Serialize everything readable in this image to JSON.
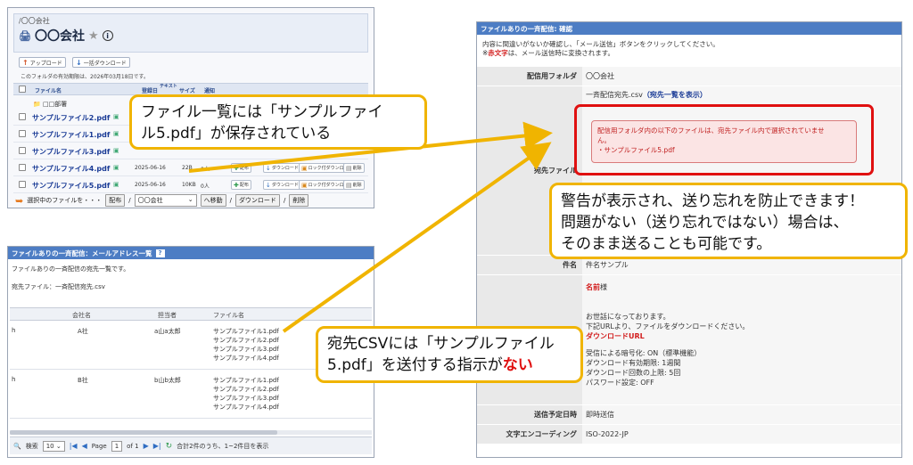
{
  "folder_panel": {
    "breadcrumb": "/〇〇会社",
    "title": "〇〇会社",
    "upload_label": "アップロード",
    "bulk_download_label": "一括ダウンロード",
    "expiry_note": "このフォルダの有効期限は、2026年03月18日です。",
    "columns": {
      "filename": "ファイル名",
      "date": "登録日",
      "text": "テキスト",
      "size": "サイズ",
      "notify": "通知"
    },
    "department": "□□部署",
    "files": [
      {
        "name": "サンプルファイル2.pdf",
        "date": "",
        "size": "",
        "count": ""
      },
      {
        "name": "サンプルファイル1.pdf",
        "date": "",
        "size": "",
        "count": ""
      },
      {
        "name": "サンプルファイル3.pdf",
        "date": "",
        "size": "",
        "count": ""
      },
      {
        "name": "サンプルファイル4.pdf",
        "date": "2025-06-16",
        "size": "22B",
        "count": "0人"
      },
      {
        "name": "サンプルファイル5.pdf",
        "date": "2025-06-16",
        "size": "10KB",
        "count": "0人"
      }
    ],
    "row_actions": {
      "distribute": "配布",
      "download": "ダウンロード",
      "locked_dl": "ロック付ダウンロード",
      "delete": "削除"
    },
    "action_bar": {
      "prefix": "選択中のファイルを・・・",
      "distribute": "配布",
      "select_value": "〇〇会社",
      "move": "へ移動",
      "download": "ダウンロード",
      "delete": "削除"
    }
  },
  "address_panel": {
    "title": "ファイルありの一斉配信：メールアドレス一覧",
    "help": "?",
    "description": "ファイルありの一斉配信の宛先一覧です。",
    "csv_label": "宛先ファイル：一斉配信宛先.csv",
    "columns": {
      "company": "会社名",
      "person": "担当者",
      "files": "ファイル名"
    },
    "rows": [
      {
        "prefix": "h",
        "company": "A社",
        "person": "a山a太郎",
        "files": [
          "サンプルファイル1.pdf",
          "サンプルファイル2.pdf",
          "サンプルファイル3.pdf",
          "サンプルファイル4.pdf"
        ]
      },
      {
        "prefix": "h",
        "company": "B社",
        "person": "b山b太郎",
        "files": [
          "サンプルファイル1.pdf",
          "サンプルファイル2.pdf",
          "サンプルファイル3.pdf",
          "サンプルファイル4.pdf"
        ]
      }
    ],
    "pager": {
      "search": "検索",
      "per_page": "10",
      "page_label": "Page",
      "page_value": "1",
      "of_label": "of 1",
      "summary": "合計2件のうち、1~2件目を表示"
    }
  },
  "confirm_panel": {
    "title": "ファイルありの一斉配信: 確認",
    "intro_line1": "内容に間違いがないか確認し、「メール送信」ボタンをクリックしてください。",
    "intro_mark": "※",
    "intro_red": "赤文字",
    "intro_rest": "は、メール送信時に変換されます。",
    "labels": {
      "folder": "配信用フォルダ",
      "dest": "宛先ファイル",
      "subject": "件名",
      "body": "本文",
      "schedule": "送信予定日時",
      "encoding": "文字エンコーディング"
    },
    "folder_value": "〇〇会社",
    "csv_file": "一斉配信宛先.csv",
    "csv_link": "（宛先一覧を表示）",
    "warning_line1": "配信用フォルダ内の以下のファイルは、宛先ファイル内で選択されていませ",
    "warning_line2": "ん。",
    "warning_line3": "・サンプルファイル5.pdf",
    "subject_value": "件名サンプル",
    "body_name": "名前",
    "body_sama": "様",
    "body_lines": [
      "お世話になっております。",
      "下記URLより、ファイルをダウンロードください。"
    ],
    "body_url": "ダウンロードURL",
    "body_settings": [
      "受信による暗号化: ON（標準機能）",
      "ダウンロード有効期限: 1週間",
      "ダウンロード回数の上限: 5回",
      "パスワード設定: OFF"
    ],
    "schedule_value": "即時送信",
    "encoding_value": "ISO-2022-JP"
  },
  "callouts": {
    "c1_line1": "ファイル一覧には「サンプルファイ",
    "c1_line2": "ル5.pdf」が保存されている",
    "c2_line1": "警告が表示され、送り忘れを防止できます！",
    "c2_line2": "問題がない（送り忘れではない）場合は、",
    "c2_line3": "そのまま送ることも可能です。",
    "c3_line1": "宛先CSVには「サンプルファイル",
    "c3_line2": "5.pdf」を送付する指示が",
    "c3_red": "ない"
  },
  "colors": {
    "accent_blue": "#4d7dc4",
    "callout_border": "#f0b400",
    "warning_red": "#e01010"
  }
}
